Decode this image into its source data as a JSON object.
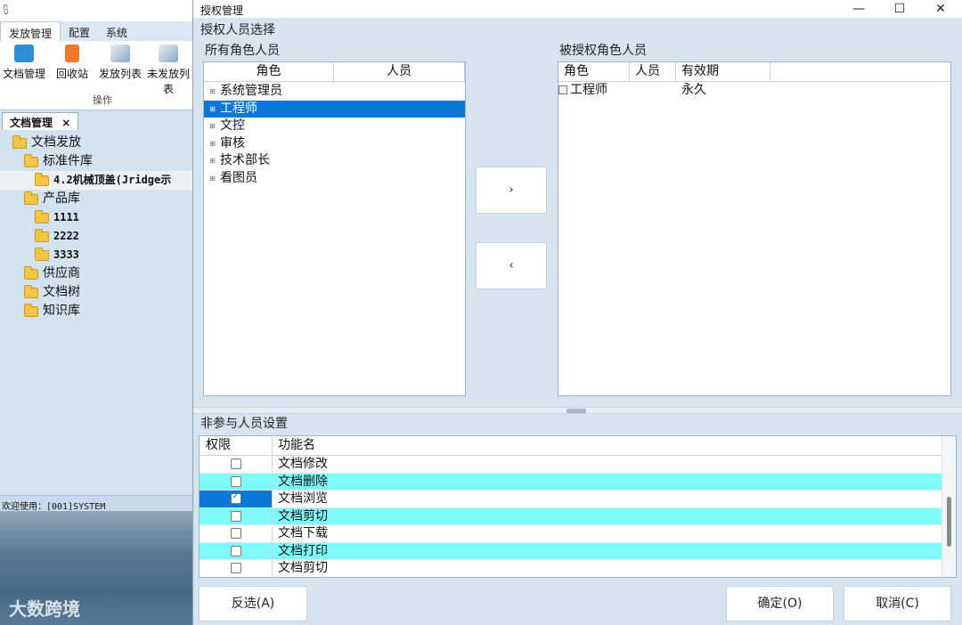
{
  "bg": {
    "title_glyph": "⩉",
    "ribbon_tabs": [
      "发放管理",
      "配置",
      "系统"
    ],
    "ribbon_buttons": [
      "文档管理",
      "回收站",
      "发放列表",
      "未发放列表"
    ],
    "ribbon_group": "操作",
    "doc_tab": "文档管理",
    "doc_tab_close": "×",
    "tree": [
      "文档发放",
      "标准件库",
      "4.2机械顶盖(Jridge示",
      "产品库",
      "1111",
      "2222",
      "3333",
      "供应商",
      "文档树",
      "知识库"
    ],
    "status": "欢迎使用：[001]SYSTEM",
    "watermark": "大数跨境"
  },
  "dialog": {
    "title": "授权管理",
    "window_controls": {
      "minimize": "—",
      "maximize": "☐",
      "close": "✕"
    },
    "section_select": "授权人员选择",
    "left_panel": {
      "label": "所有角色人员",
      "columns": [
        "角色",
        "人员"
      ],
      "rows": [
        "系统管理员",
        "工程师",
        "文控",
        "审核",
        "技术部长",
        "看图员"
      ],
      "expander": "⊞"
    },
    "move_right": "›",
    "move_left": "‹",
    "right_panel": {
      "label": "被授权角色人员",
      "columns": [
        "角色",
        "人员",
        "有效期"
      ],
      "rows": [
        {
          "role": "工程师",
          "person": "",
          "validity": "永久"
        }
      ]
    },
    "section_non": "非参与人员设置",
    "func_grid": {
      "columns": [
        "权限",
        "功能名"
      ],
      "rows": [
        {
          "name": "文档修改",
          "checked": false
        },
        {
          "name": "文档删除",
          "checked": false
        },
        {
          "name": "文档浏览",
          "checked": true
        },
        {
          "name": "文档剪切",
          "checked": false
        },
        {
          "name": "文档下载",
          "checked": false
        },
        {
          "name": "文档打印",
          "checked": false
        },
        {
          "name": "文档剪切",
          "checked": false
        }
      ]
    },
    "buttons": {
      "invert": "反选(A)",
      "ok": "确定(O)",
      "cancel": "取消(C)"
    }
  }
}
